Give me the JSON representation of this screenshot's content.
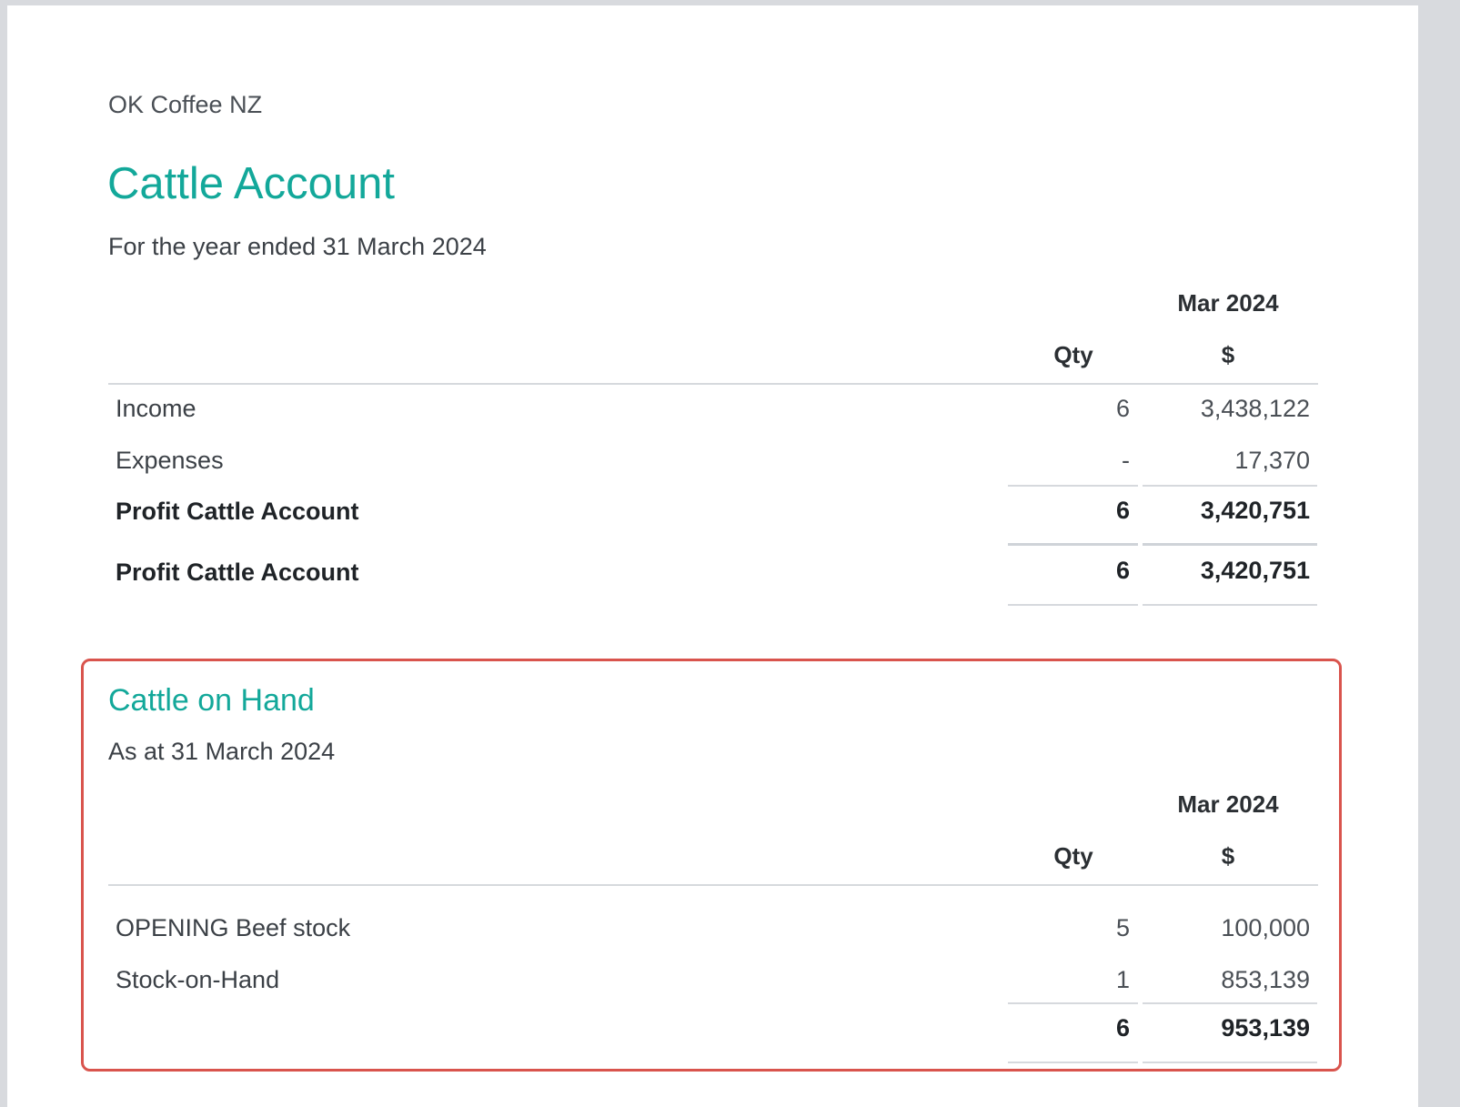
{
  "organisation": "OK Coffee NZ",
  "report_title": "Cattle Account",
  "report_subtitle": "For the year ended 31 March 2024",
  "account_table": {
    "period": "Mar 2024",
    "qty_header": "Qty",
    "amount_header": "$",
    "rows": [
      {
        "label": "Income",
        "qty": "6",
        "amount": "3,438,122"
      },
      {
        "label": "Expenses",
        "qty": "-",
        "amount": "17,370"
      },
      {
        "label": "Profit Cattle Account",
        "qty": "6",
        "amount": "3,420,751"
      }
    ],
    "total": {
      "label": "Profit Cattle Account",
      "qty": "6",
      "amount": "3,420,751"
    }
  },
  "on_hand": {
    "title": "Cattle on Hand",
    "subtitle": "As at 31 March 2024",
    "period": "Mar 2024",
    "qty_header": "Qty",
    "amount_header": "$",
    "rows": [
      {
        "label": "OPENING Beef stock",
        "qty": "5",
        "amount": "100,000"
      },
      {
        "label": "Stock-on-Hand",
        "qty": "1",
        "amount": "853,139"
      }
    ],
    "total": {
      "qty": "6",
      "amount": "953,139"
    }
  },
  "colors": {
    "accent": "#13a89a",
    "highlight_border": "#d9544d"
  }
}
